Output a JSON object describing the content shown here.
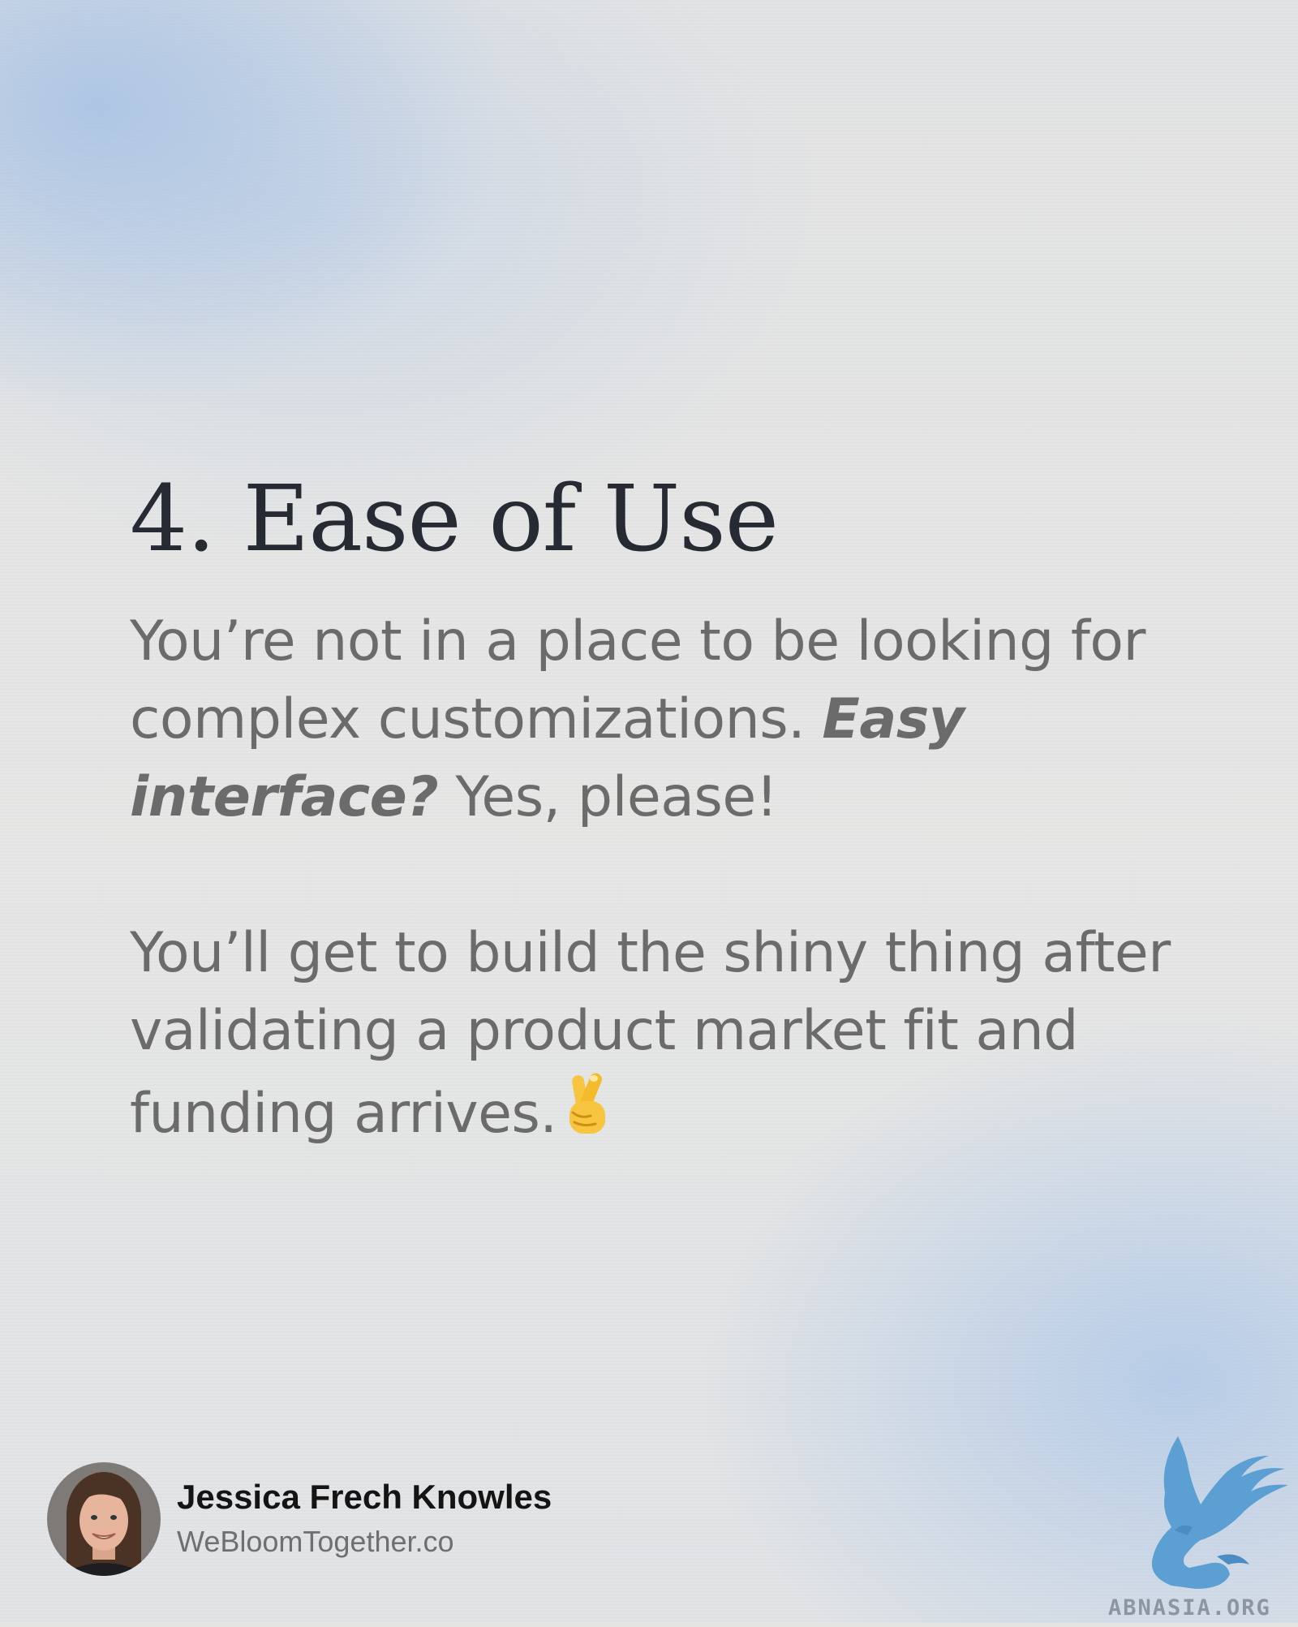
{
  "slide": {
    "title": "4. Ease of Use",
    "paragraph1": {
      "before": "You’re not in a place to be looking for complex customizations. ",
      "emphasis": "Easy interface?",
      "after": " Yes, please!"
    },
    "paragraph2": {
      "text": "You’ll get to build the shiny thing after validating a product market fit and funding arrives."
    }
  },
  "author": {
    "name": "Jessica Frech Knowles",
    "site": "WeBloomTogether.co"
  },
  "watermark": {
    "text": "ABNASIA.ORG"
  },
  "icons": {
    "emoji": "crossed-fingers-icon",
    "logo": "griffin-logo-icon",
    "avatar": "author-photo"
  },
  "colors": {
    "title": "#262a33",
    "body": "#6b6b6b",
    "name": "#141414",
    "site": "#6f6f6f",
    "accent_blue": "#5b9fd3"
  }
}
